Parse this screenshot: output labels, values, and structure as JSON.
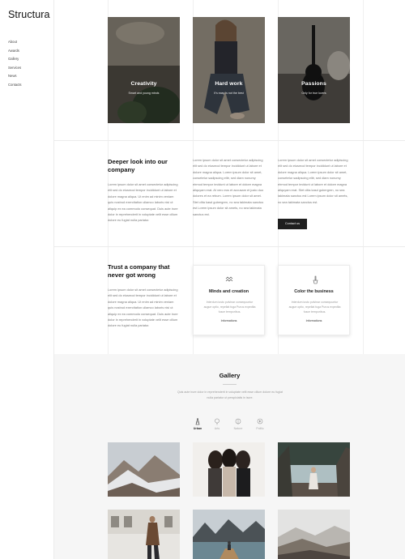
{
  "brand": {
    "logo": "Structura"
  },
  "nav": [
    "About",
    "Awards",
    "Gallery",
    "Services",
    "News",
    "Contacts"
  ],
  "hero": [
    {
      "title": "Creativity",
      "subtitle": "Smart and young minds"
    },
    {
      "title": "Hard work",
      "subtitle": "It's easy is not the best"
    },
    {
      "title": "Passions",
      "subtitle": "Only for true lovers"
    }
  ],
  "about": {
    "heading": "Deeper look into our company",
    "para1": "Lorem ipsum dolor sit amet consectetur adipiscing elit sed do eiusmod tempor incididunt ut labore et dolore magna aliqua. Ut enim ad minim veniam quis nostrud exercitation ullamco laboris nisi ut aliquip ex ea commodo consequat. Duis aute irure dolor in reprehenderit in voluptate velit esse cillum dolore eu fugiat nulla pariatur.",
    "para2": "Lorem ipsum dolor sit amet consectetur adipiscing elit sed do eiusmod tempor incididunt ut labore et dolore magna aliqua. Lorem ipsum dolor sit amet, consetetur sadipscing elitr, sed diam nonumy eirmod tempor invidunt ut labore et dolore magna aliquyam erat. At vero eos et accusam et justo duo dolores et ea rebum. Lorem ipsum dolor sit amet. Stet clita kasd gubergren, no sea takimata sanctus est Lorem ipsum dolor sit amets, no sea takimata sanctus est.",
    "para3": "Lorem ipsum dolor sit amet consectetur adipiscing elit sed do eiusmod tempor incididunt ut labore et dolore magna aliqua. Lorem ipsum dolor sit amet, consetetur sadipscing elitr, sed diam nonumy eirmod tempor invidunt ut labore et dolore magna aliquyam erat. Stet clita kasd gubergren, no sea takimata sanctus est Lorem ipsum dolor sit amets, no sea takimata sanctus est.",
    "button": "Contact us"
  },
  "trust": {
    "heading": "Trust a company that never got wrong",
    "para": "Lorem ipsum dolor sit amet consectetur adipiscing elit sed do eiusmod tempor incididunt ut labore et dolore magna aliqua. Ut enim ad minim veniam quis nostrud exercitation ullamco laboris nisi ut aliquip ex ea commodo consequat. Duis aute irure dolor in reprehenderit in voluptate velit esse cillum dolore eu fugiat nulla pariatur."
  },
  "features": [
    {
      "icon": "waves-icon",
      "title": "Minds and creation",
      "text": "Interdum iusto pulvinar consequuntur augue optio, repellat fuga Purus expedita fusce temporibus.",
      "link": "Informations"
    },
    {
      "icon": "brush-icon",
      "title": "Color the business",
      "text": "Interdum iusto pulvinar consequuntur augue optio, repellat fuga Purus expedita fusce temporibus.",
      "link": "Informations"
    }
  ],
  "gallery": {
    "title": "Gallery",
    "description": "Quis aute irure dolor in reprehenderit in voluptate velit esse cillum dolore eu fugiat nulla pariatur ut perspiciatis in iscre.",
    "filters": [
      {
        "label": "Urban",
        "icon": "tower-icon",
        "active": true
      },
      {
        "label": "Arts",
        "icon": "bulb-icon",
        "active": false
      },
      {
        "label": "Nature",
        "icon": "leaf-icon",
        "active": false
      },
      {
        "label": "Politic",
        "icon": "flag-icon",
        "active": false
      }
    ]
  }
}
